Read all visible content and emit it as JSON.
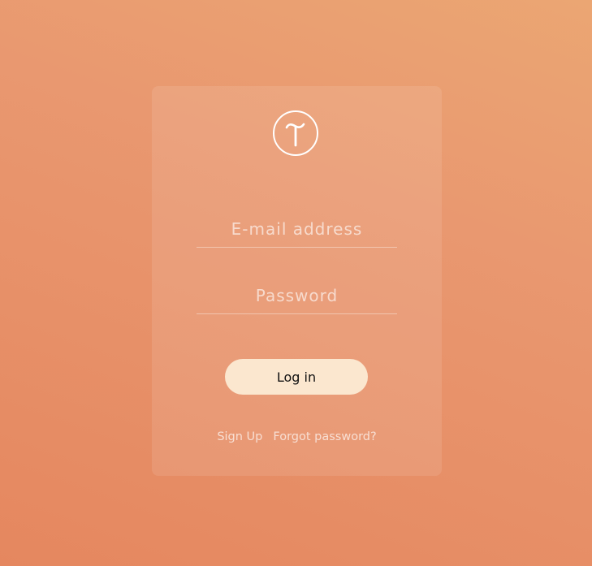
{
  "brand": {
    "logo_icon": "tilda-logo-icon"
  },
  "form": {
    "email_placeholder": "E-mail address",
    "email_value": "",
    "password_placeholder": "Password",
    "password_value": "",
    "login_label": "Log in"
  },
  "links": {
    "signup_label": "Sign Up",
    "forgot_label": "Forgot password?"
  },
  "colors": {
    "background_top": "#eba673",
    "background_bottom": "#e5875f",
    "button_fill": "#fbe7cf",
    "button_text": "#111111"
  }
}
